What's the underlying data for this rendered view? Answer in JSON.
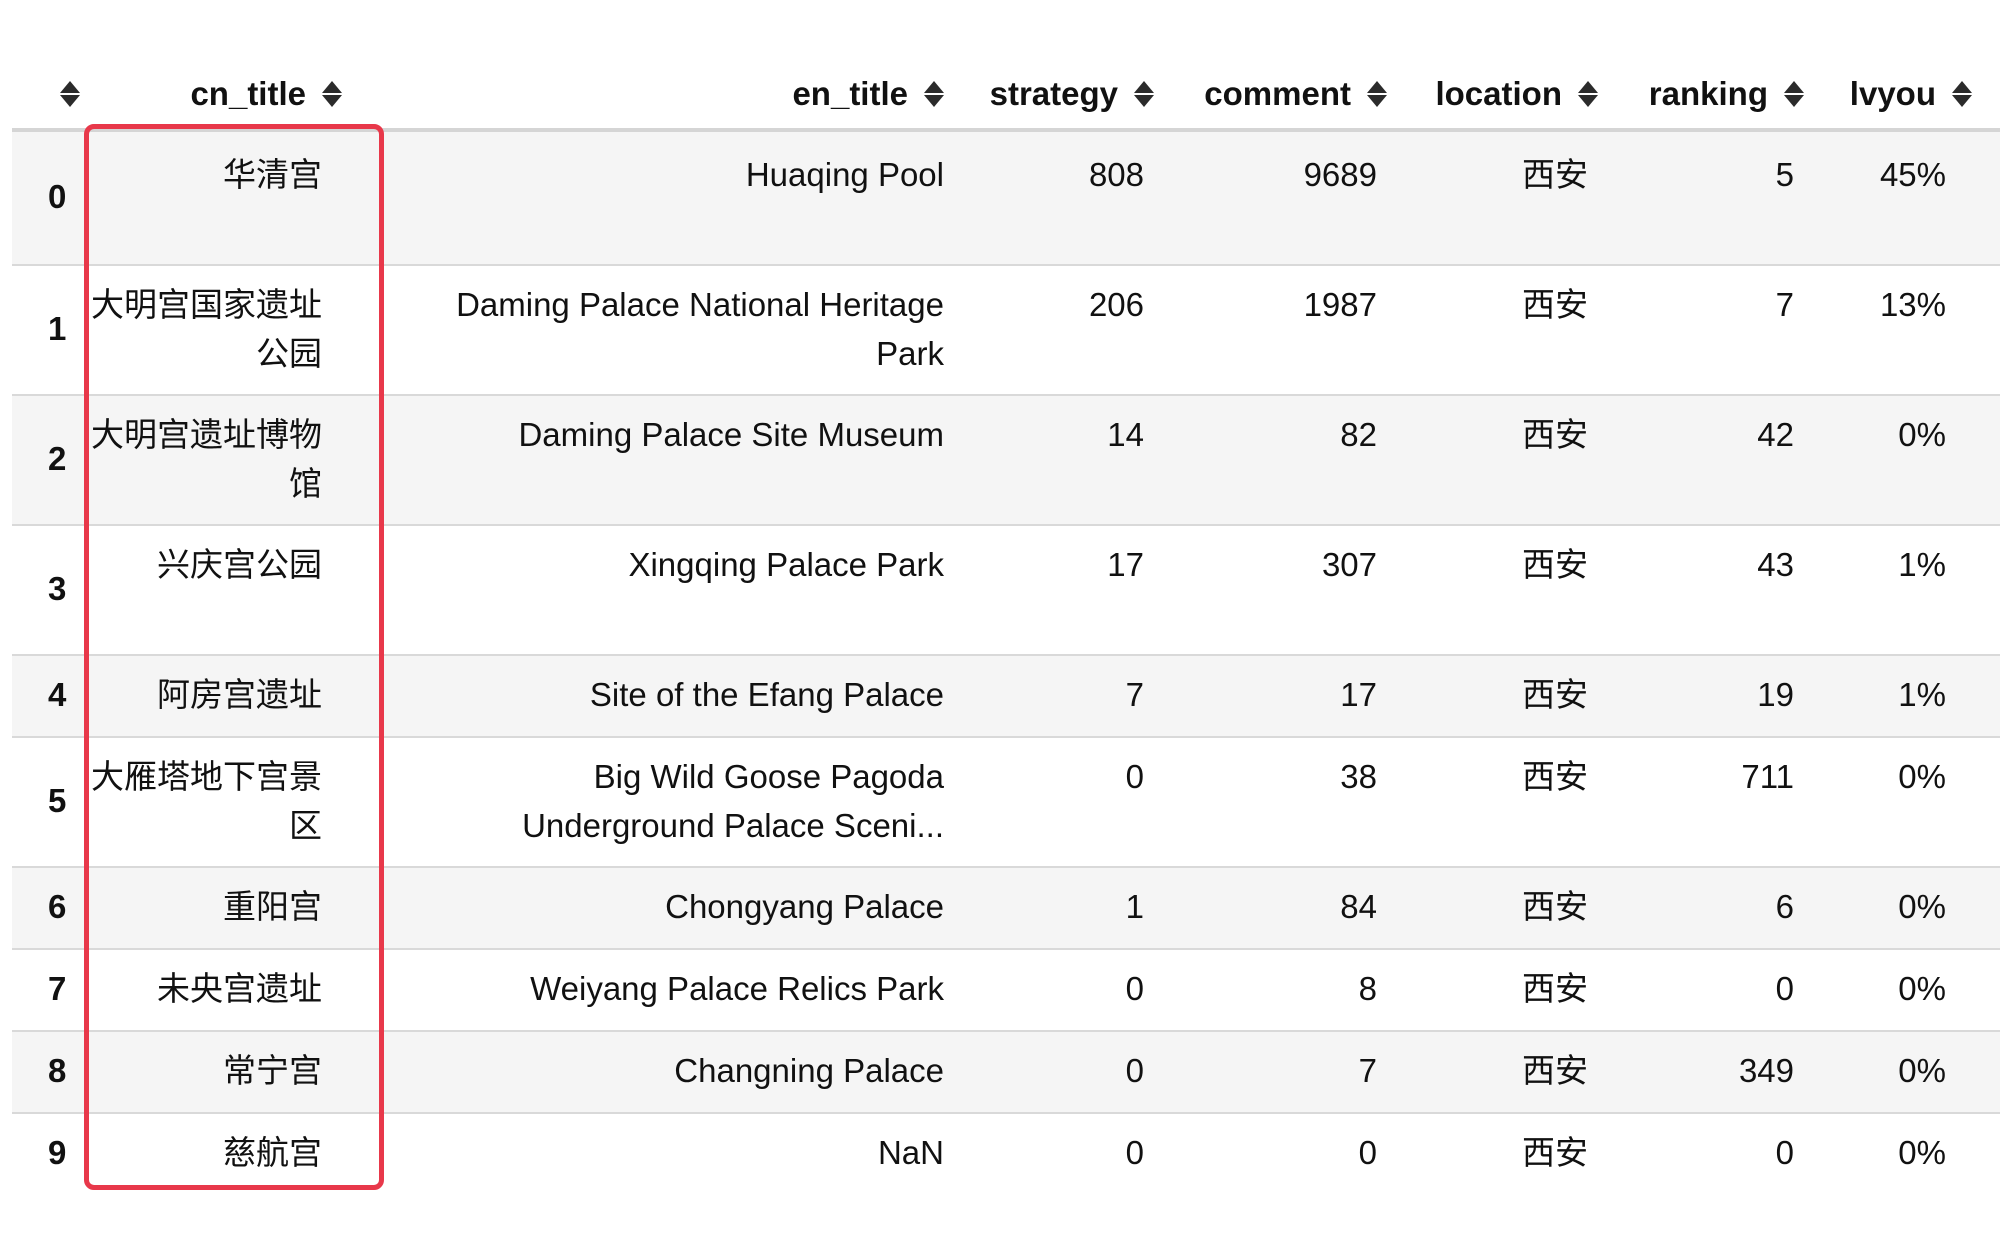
{
  "columns": {
    "index_header": "",
    "cn_title": "cn_title",
    "en_title": "en_title",
    "strategy": "strategy",
    "comment": "comment",
    "location": "location",
    "ranking": "ranking",
    "lvyou": "lvyou"
  },
  "rows": [
    {
      "idx": "0",
      "cn_title": "华清宫",
      "en_title": "Huaqing Pool",
      "strategy": "808",
      "comment": "9689",
      "location": "西安",
      "ranking": "5",
      "lvyou": "45%",
      "overflow": "∫"
    },
    {
      "idx": "1",
      "cn_title": "大明宫国家遗址公园",
      "en_title": "Daming Palace National Heritage Park",
      "strategy": "206",
      "comment": "1987",
      "location": "西安",
      "ranking": "7",
      "lvyou": "13%",
      "overflow": "⌈"
    },
    {
      "idx": "2",
      "cn_title": "大明宫遗址博物馆",
      "en_title": "Daming Palace Site Museum",
      "strategy": "14",
      "comment": "82",
      "location": "西安",
      "ranking": "42",
      "lvyou": "0%",
      "overflow": ""
    },
    {
      "idx": "3",
      "cn_title": "兴庆宫公园",
      "en_title": "Xingqing Palace Park",
      "strategy": "17",
      "comment": "307",
      "location": "西安",
      "ranking": "43",
      "lvyou": "1%",
      "overflow": "∫"
    },
    {
      "idx": "4",
      "cn_title": "阿房宫遗址",
      "en_title": "Site of the Efang Palace",
      "strategy": "7",
      "comment": "17",
      "location": "西安",
      "ranking": "19",
      "lvyou": "1%",
      "overflow": ""
    },
    {
      "idx": "5",
      "cn_title": "大雁塔地下宫景区",
      "en_title": "Big Wild Goose Pagoda Underground Palace Sceni...",
      "strategy": "0",
      "comment": "38",
      "location": "西安",
      "ranking": "711",
      "lvyou": "0%",
      "overflow": ""
    },
    {
      "idx": "6",
      "cn_title": "重阳宫",
      "en_title": "Chongyang Palace",
      "strategy": "1",
      "comment": "84",
      "location": "西安",
      "ranking": "6",
      "lvyou": "0%",
      "overflow": ""
    },
    {
      "idx": "7",
      "cn_title": "未央宫遗址",
      "en_title": "Weiyang Palace Relics Park",
      "strategy": "0",
      "comment": "8",
      "location": "西安",
      "ranking": "0",
      "lvyou": "0%",
      "overflow": ""
    },
    {
      "idx": "8",
      "cn_title": "常宁宫",
      "en_title": "Changning Palace",
      "strategy": "0",
      "comment": "7",
      "location": "西安",
      "ranking": "349",
      "lvyou": "0%",
      "overflow": ""
    },
    {
      "idx": "9",
      "cn_title": "慈航宫",
      "en_title": "NaN",
      "strategy": "0",
      "comment": "0",
      "location": "西安",
      "ranking": "0",
      "lvyou": "0%",
      "overflow": ""
    }
  ],
  "colors": {
    "highlight_border": "#e8384a",
    "row_stripe": "#f5f5f5",
    "grid_line": "#d9d9d9"
  },
  "icons": {
    "sort": "sort-updown-icon"
  }
}
